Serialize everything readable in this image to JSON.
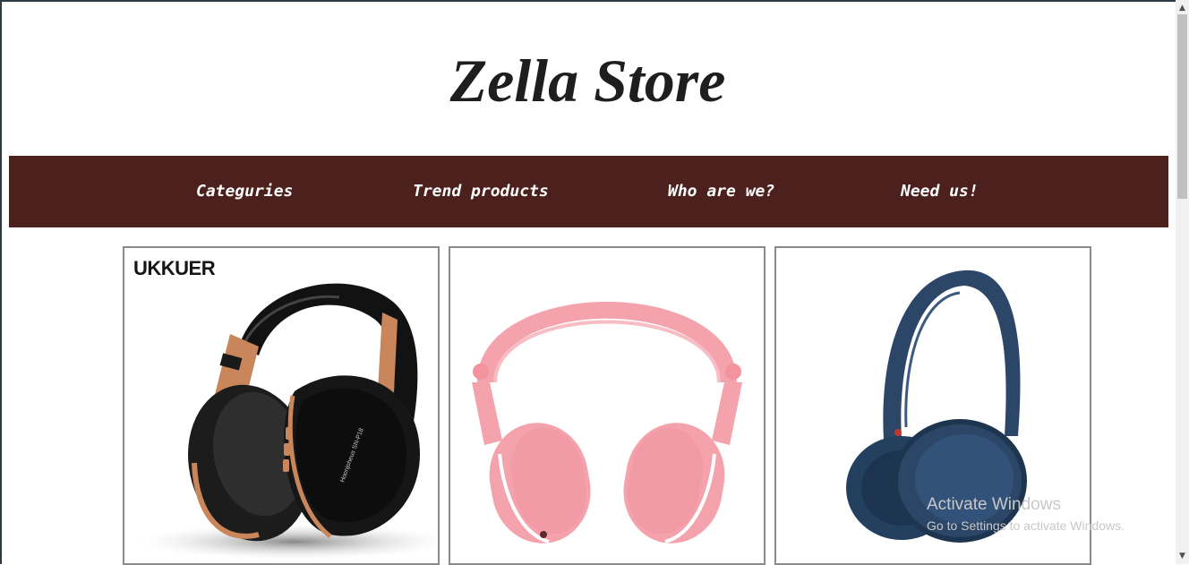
{
  "site": {
    "title": "Zella Store"
  },
  "nav": {
    "items": [
      {
        "label": "Categuries"
      },
      {
        "label": "Trend products"
      },
      {
        "label": "Who are we?"
      },
      {
        "label": "Need us!"
      }
    ]
  },
  "products": [
    {
      "brand_logo": "UKKUER",
      "headband_text": "Hoonjoheus SN-P18",
      "image": "black-copper-headphones",
      "color": "#1a1a1a",
      "accent": "#c8865a"
    },
    {
      "image": "pink-headphones",
      "color": "#f4a3ad"
    },
    {
      "image": "navy-headphones",
      "color": "#2c4668"
    }
  ],
  "watermark": {
    "title": "Activate Windows",
    "subtitle": "Go to Settings to activate Windows."
  },
  "colors": {
    "nav_background": "#4c201c",
    "title_text": "#1e1e1e",
    "card_border": "#8a8a8a"
  }
}
